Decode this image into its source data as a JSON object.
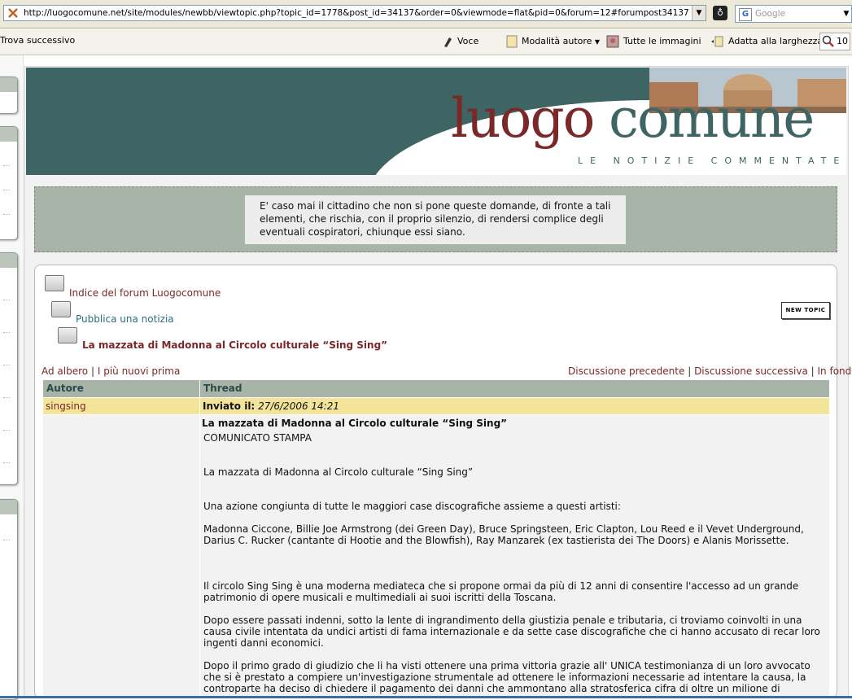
{
  "browser": {
    "url": "http://luogocomune.net/site/modules/newbb/viewtopic.php?topic_id=1778&post_id=34137&order=0&viewmode=flat&pid=0&forum=12#forumpost34137",
    "search_placeholder": "Google"
  },
  "toolbar": {
    "find_next": "Trova successivo",
    "voice": "Voce",
    "author_mode": "Modalità autore",
    "all_images": "Tutte le immagini",
    "fit_width": "Adatta alla larghezza",
    "zoom": "10"
  },
  "banner": {
    "logo_part1": "luogo",
    "logo_part2": "comune",
    "tagline": "LE NOTIZIE COMMENTATE"
  },
  "quote": "E' caso mai il cittadino che non si pone queste domande, di fronte a tali elementi,  che rischia, con il proprio silenzio, di rendersi complice degli eventuali cospiratori, chiunque essi siano.",
  "breadcrumb": {
    "index": "Indice del forum Luogocomune",
    "forum": "Pubblica una notizia",
    "topic": "La mazzata di Madonna al Circolo culturale “Sing Sing”"
  },
  "new_topic_label": "NEW TOPIC",
  "nav": {
    "tree": "Ad albero",
    "newest_first": "I più nuovi prima",
    "prev": "Discussione precedente",
    "next": "Discussione successiva",
    "bottom": "In fondo",
    "sep": "|"
  },
  "table": {
    "col_author": "Autore",
    "col_thread": "Thread",
    "author": "singsing",
    "sent_label": "Inviato il:",
    "sent_date": "27/6/2006 14:21"
  },
  "post": {
    "title": "La mazzata di Madonna al Circolo culturale “Sing Sing”",
    "paragraphs": [
      "COMUNICATO STAMPA",
      "La mazzata di Madonna al Circolo culturale “Sing Sing”",
      "Una azione congiunta di tutte le maggiori case discografiche assieme a questi artisti:",
      "Madonna Ciccone, Billie Joe Armstrong (dei Green Day), Bruce Springsteen, Eric Clapton, Lou Reed e il Vevet Underground, Darius C. Rucker (cantante di Hootie and the Blowfish), Ray Manzarek (ex tastierista dei The Doors) e Alanis Morissette.",
      "Il circolo Sing Sing è una moderna mediateca che si propone ormai da più di 12 anni di consentire l'accesso ad un grande patrimonio di opere musicali e multimediali ai suoi iscritti della Toscana.",
      "Dopo essere passati indenni, sotto la lente di ingrandimento della giustizia penale e tributaria, ci troviamo coinvolti in una causa civile intentata da undici artisti di fama internazionale e da sette case discografiche che ci hanno accusato di recar loro ingenti danni economici.",
      "Dopo il primo grado di giudizio che li ha visti ottenere una prima vittoria grazie all' UNICA testimonianza di un loro avvocato che si è prestato a compiere un'investigazione strumentale ad ottenere le informazioni necessarie ad intentare la causa, la controparte ha deciso di chiedere il pagamento dei danni che ammontano alla stratosferica cifra di oltre un milione di"
    ]
  }
}
